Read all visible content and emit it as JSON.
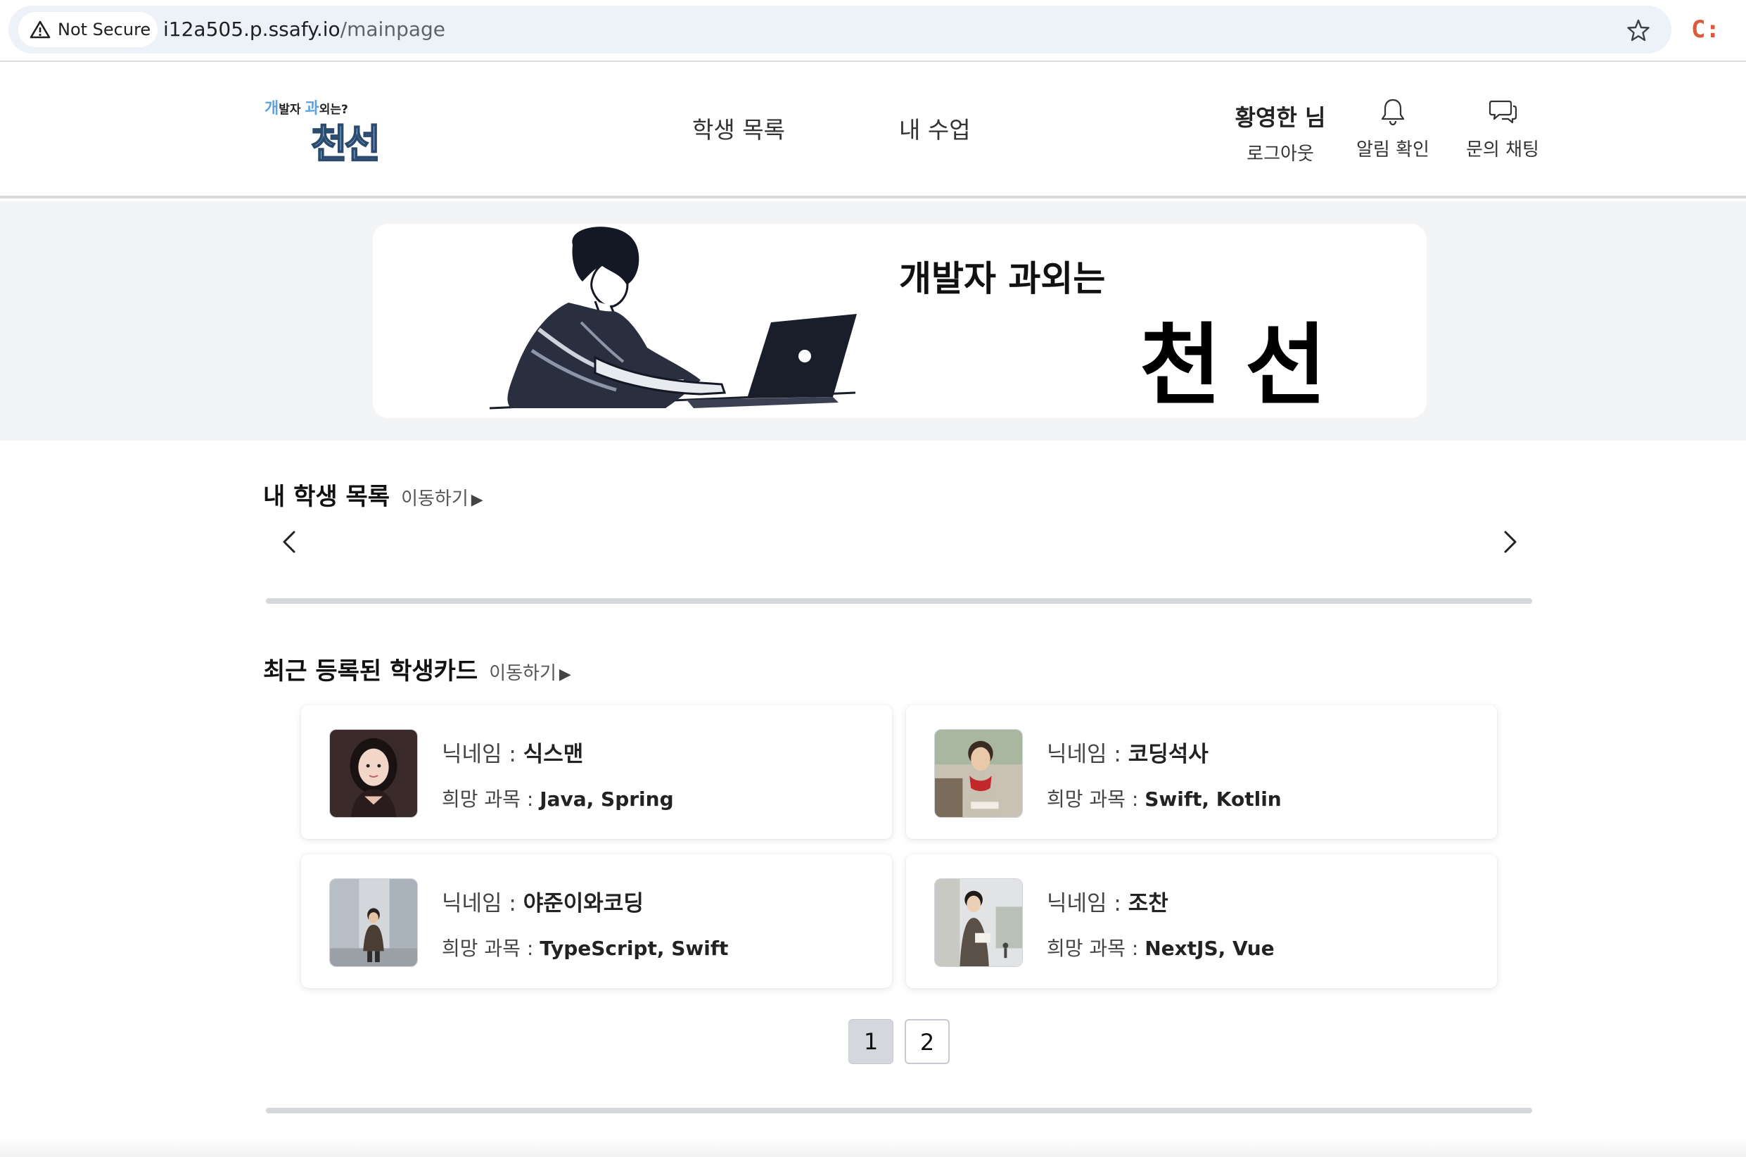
{
  "browser": {
    "security_label": "Not Secure",
    "url_host": "i12a505.p.ssafy.io",
    "url_path": "/mainpage",
    "extension_label": "C:"
  },
  "header": {
    "logo": {
      "small_prefix": "개",
      "small_mid1": "발자 ",
      "small_mid2": "과",
      "small_suffix": "외는?",
      "big": "천선"
    },
    "nav": [
      "학생 목록",
      "내 수업"
    ],
    "user_name": "황영한 님",
    "logout": "로그아웃",
    "actions": [
      {
        "label": "알림 확인",
        "icon": "bell-icon"
      },
      {
        "label": "문의 채팅",
        "icon": "chat-icon"
      }
    ]
  },
  "banner": {
    "subtitle": "개발자 과외는",
    "title": "천선"
  },
  "my_students": {
    "title": "내 학생 목록",
    "link": "이동하기",
    "link_icon": "▶"
  },
  "recent_cards": {
    "title": "최근 등록된 학생카드",
    "link": "이동하기",
    "link_icon": "▶",
    "nickname_label": "닉네임 : ",
    "subject_label": "희망 과목 : ",
    "cards": [
      {
        "nickname": "식스맨",
        "subjects": "Java, Spring"
      },
      {
        "nickname": "코딩석사",
        "subjects": "Swift, Kotlin"
      },
      {
        "nickname": "야준이와코딩",
        "subjects": "TypeScript, Swift"
      },
      {
        "nickname": "조찬",
        "subjects": "NextJS, Vue"
      }
    ]
  },
  "pagination": {
    "pages": [
      "1",
      "2"
    ],
    "current": "1"
  },
  "colors": {
    "accent_blue": "#8fc4ee",
    "band_gray": "#f3f4f6",
    "divider": "#d4d7dc"
  }
}
